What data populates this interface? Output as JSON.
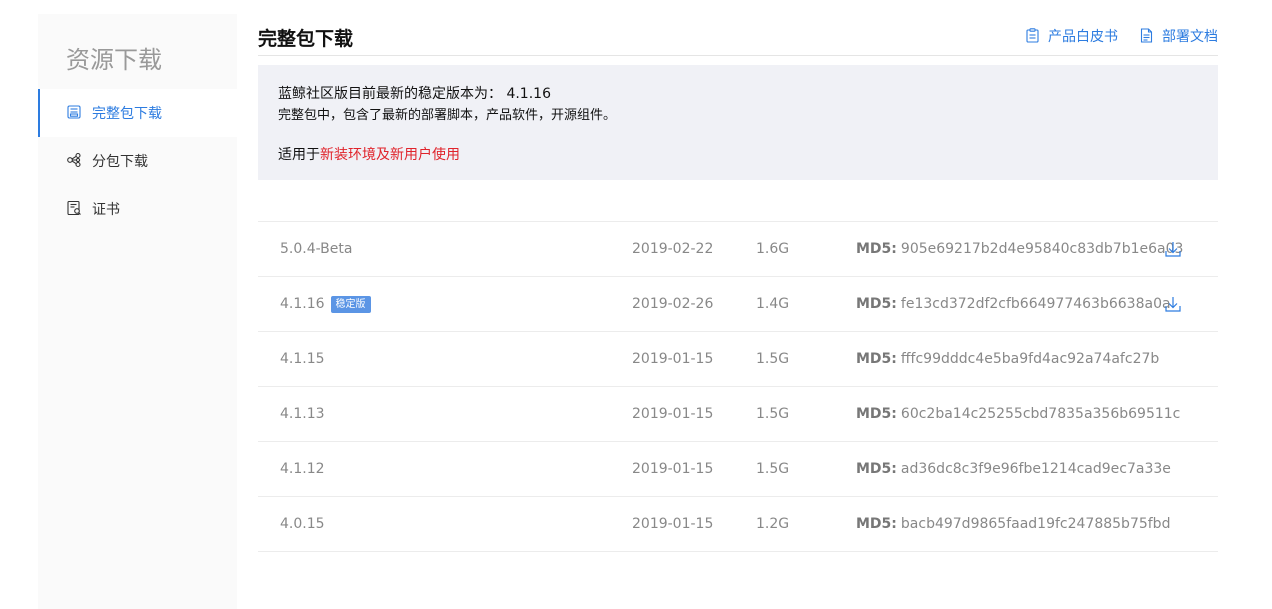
{
  "sidebar": {
    "title": "资源下载",
    "items": [
      {
        "label": "完整包下载",
        "icon": "package-icon",
        "active": true
      },
      {
        "label": "分包下载",
        "icon": "share-nodes-icon",
        "active": false
      },
      {
        "label": "证书",
        "icon": "certificate-icon",
        "active": false
      }
    ]
  },
  "header": {
    "title": "完整包下载",
    "links": [
      {
        "label": "产品白皮书",
        "icon": "clipboard-icon"
      },
      {
        "label": "部署文档",
        "icon": "document-icon"
      }
    ]
  },
  "info": {
    "line1_prefix": "蓝鲸社区版目前最新的稳定版本为：",
    "line1_version": "4.1.16",
    "line2": "完整包中，包含了最新的部署脚本，产品软件，开源组件。",
    "line3_prefix": "适用于",
    "line3_highlight": "新装环境及新用户使用"
  },
  "colors": {
    "accent": "#2d7ce0",
    "highlight_red": "#e0232b",
    "badge": "#5b95e5",
    "info_bg": "#f0f1f6"
  },
  "table": {
    "md5_label": "MD5:",
    "rows": [
      {
        "version": "5.0.4-Beta",
        "badge": "",
        "date": "2019-02-22",
        "size": "1.6G",
        "md5": "905e69217b2d4e95840c83db7b1e6a03",
        "download": true
      },
      {
        "version": "4.1.16",
        "badge": "稳定版",
        "date": "2019-02-26",
        "size": "1.4G",
        "md5": "fe13cd372df2cfb664977463b6638a0a",
        "download": true
      },
      {
        "version": "4.1.15",
        "badge": "",
        "date": "2019-01-15",
        "size": "1.5G",
        "md5": "fffc99dddc4e5ba9fd4ac92a74afc27b",
        "download": false
      },
      {
        "version": "4.1.13",
        "badge": "",
        "date": "2019-01-15",
        "size": "1.5G",
        "md5": "60c2ba14c25255cbd7835a356b69511c",
        "download": false
      },
      {
        "version": "4.1.12",
        "badge": "",
        "date": "2019-01-15",
        "size": "1.5G",
        "md5": "ad36dc8c3f9e96fbe1214cad9ec7a33e",
        "download": false
      },
      {
        "version": "4.0.15",
        "badge": "",
        "date": "2019-01-15",
        "size": "1.2G",
        "md5": "bacb497d9865faad19fc247885b75fbd",
        "download": false
      }
    ]
  }
}
